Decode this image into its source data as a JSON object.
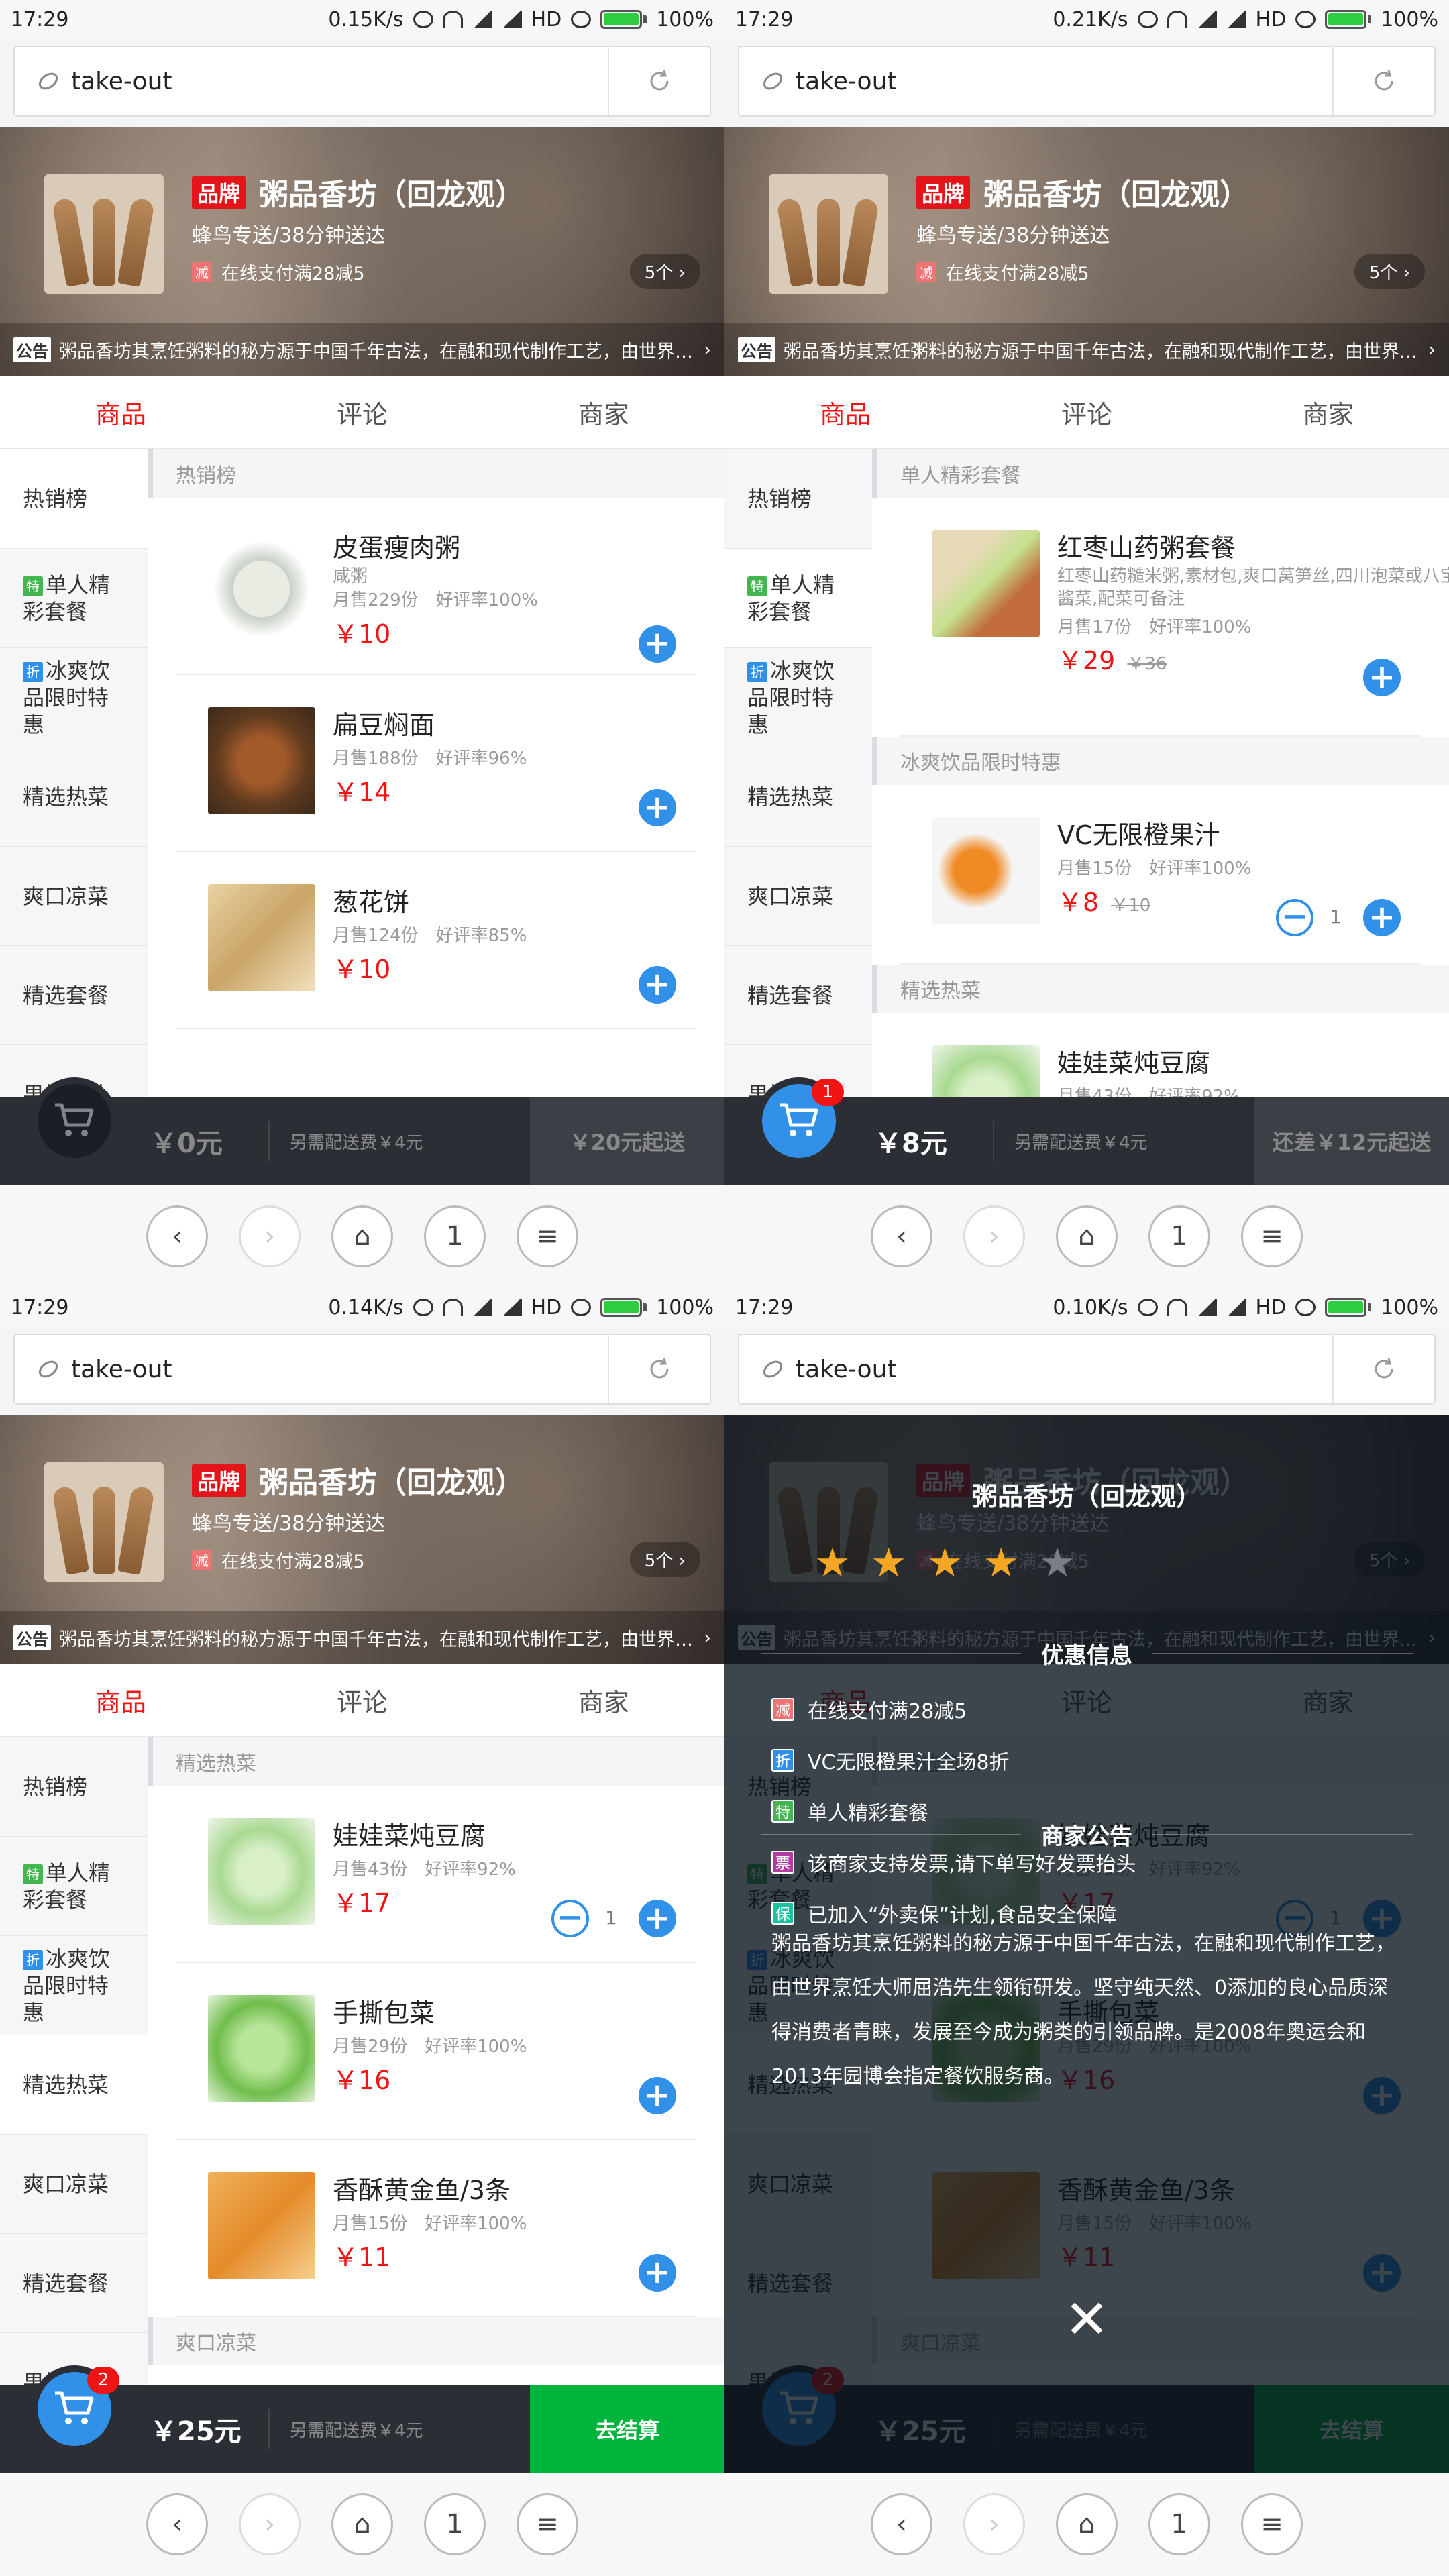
{
  "status": [
    {
      "time": "17:29",
      "speed": "0.15K/s",
      "hd": "HD",
      "battery": "100%"
    },
    {
      "time": "17:29",
      "speed": "0.21K/s",
      "hd": "HD",
      "battery": "100%"
    },
    {
      "time": "17:29",
      "speed": "0.14K/s",
      "hd": "HD",
      "battery": "100%"
    },
    {
      "time": "17:29",
      "speed": "0.10K/s",
      "hd": "HD",
      "battery": "100%"
    }
  ],
  "url": "take-out",
  "shop": {
    "brand_badge": "品牌",
    "name": "粥品香坊（回龙观）",
    "delivery": "蜂鸟专送/38分钟送达",
    "promo_badge": "减",
    "promo": "在线支付满28减5",
    "promo_count": "5个 ›",
    "notice_tag": "公告",
    "notice": "粥品香坊其烹饪粥料的秘方源于中国千年古法，在融和现代制作工艺，由世界烹饪大师屈浩先生领衔研发。",
    "notice_chev": "›"
  },
  "tabs": [
    "商品",
    "评论",
    "商家"
  ],
  "sidebar": [
    {
      "badge": "",
      "label": "热销榜"
    },
    {
      "badge": "特",
      "label": "单人精彩套餐"
    },
    {
      "badge": "折",
      "label": "冰爽饮品限时特惠"
    },
    {
      "badge": "",
      "label": "精选热菜"
    },
    {
      "badge": "",
      "label": "爽口凉菜"
    },
    {
      "badge": "",
      "label": "精选套餐"
    },
    {
      "badge": "",
      "label": "果拼果汁"
    }
  ],
  "foods": {
    "hot_title": "热销榜",
    "f1": {
      "name": "皮蛋瘦肉粥",
      "desc": "咸粥",
      "sales": "月售229份",
      "rating": "好评率100%",
      "price": "￥10"
    },
    "f2": {
      "name": "扁豆焖面",
      "sales": "月售188份",
      "rating": "好评率96%",
      "price": "￥14"
    },
    "f3": {
      "name": "葱花饼",
      "sales": "月售124份",
      "rating": "好评率85%",
      "price": "￥10"
    },
    "single_title": "单人精彩套餐",
    "f4": {
      "name": "红枣山药粥套餐",
      "desc": "红枣山药糙米粥,素材包,爽口莴笋丝,四川泡菜或八宝酱菜,配菜可备注",
      "sales": "月售17份",
      "rating": "好评率100%",
      "price": "￥29",
      "old": "￥36"
    },
    "drink_title": "冰爽饮品限时特惠",
    "f5": {
      "name": "VC无限橙果汁",
      "sales": "月售15份",
      "rating": "好评率100%",
      "price": "￥8",
      "old": "￥10",
      "qty": "1"
    },
    "hotdish_title": "精选热菜",
    "f6": {
      "name": "娃娃菜炖豆腐",
      "sales": "月售43份",
      "rating": "好评率92%",
      "price": "￥17",
      "qty": "1"
    },
    "f7": {
      "name": "手撕包菜",
      "sales": "月售29份",
      "rating": "好评率100%",
      "price": "￥16"
    },
    "f8": {
      "name": "香酥黄金鱼/3条",
      "sales": "月售15份",
      "rating": "好评率100%",
      "price": "￥11"
    },
    "cold_title": "爽口凉菜"
  },
  "carts": [
    {
      "badge": "",
      "total": "￥0元",
      "deliver": "另需配送费￥4元",
      "action": "￥20元起送"
    },
    {
      "badge": "1",
      "total": "￥8元",
      "deliver": "另需配送费￥4元",
      "action": "还差￥12元起送"
    },
    {
      "badge": "2",
      "total": "￥25元",
      "deliver": "另需配送费￥4元",
      "action": "去结算"
    },
    {
      "badge": "2",
      "total": "￥25元",
      "deliver": "另需配送费￥4元",
      "action": "去结算"
    }
  ],
  "nav": {
    "back": "‹",
    "forward": "›",
    "home": "⌂",
    "tabs": "1",
    "menu": "≡"
  },
  "detail": {
    "title": "粥品香坊（回龙观）",
    "rating_stars": 4,
    "rating_max": 5,
    "supports_title": "优惠信息",
    "supports": [
      {
        "badge": "减",
        "color": "#f07373",
        "text": "在线支付满28减5"
      },
      {
        "badge": "折",
        "color": "#3190e8",
        "text": "VC无限橙果汁全场8折"
      },
      {
        "badge": "特",
        "color": "#43b651",
        "text": "单人精彩套餐"
      },
      {
        "badge": "票",
        "color": "#b33ca0",
        "text": "该商家支持发票,请下单写好发票抬头"
      },
      {
        "badge": "保",
        "color": "#1bc1a0",
        "text": "已加入“外卖保”计划,食品安全保障"
      }
    ],
    "bulletin_title": "商家公告",
    "bulletin": "粥品香坊其烹饪粥料的秘方源于中国千年古法，在融和现代制作工艺，由世界烹饪大师屈浩先生领衔研发。坚守纯天然、0添加的良心品质深得消费者青睐，发展至今成为粥类的引领品牌。是2008年奥运会和2013年园博会指定餐饮服务商。",
    "close": "✕"
  },
  "colors": {
    "accent": "#3190e8",
    "price": "#f01414",
    "checkout": "#00b43c",
    "star": "#f5a623"
  }
}
